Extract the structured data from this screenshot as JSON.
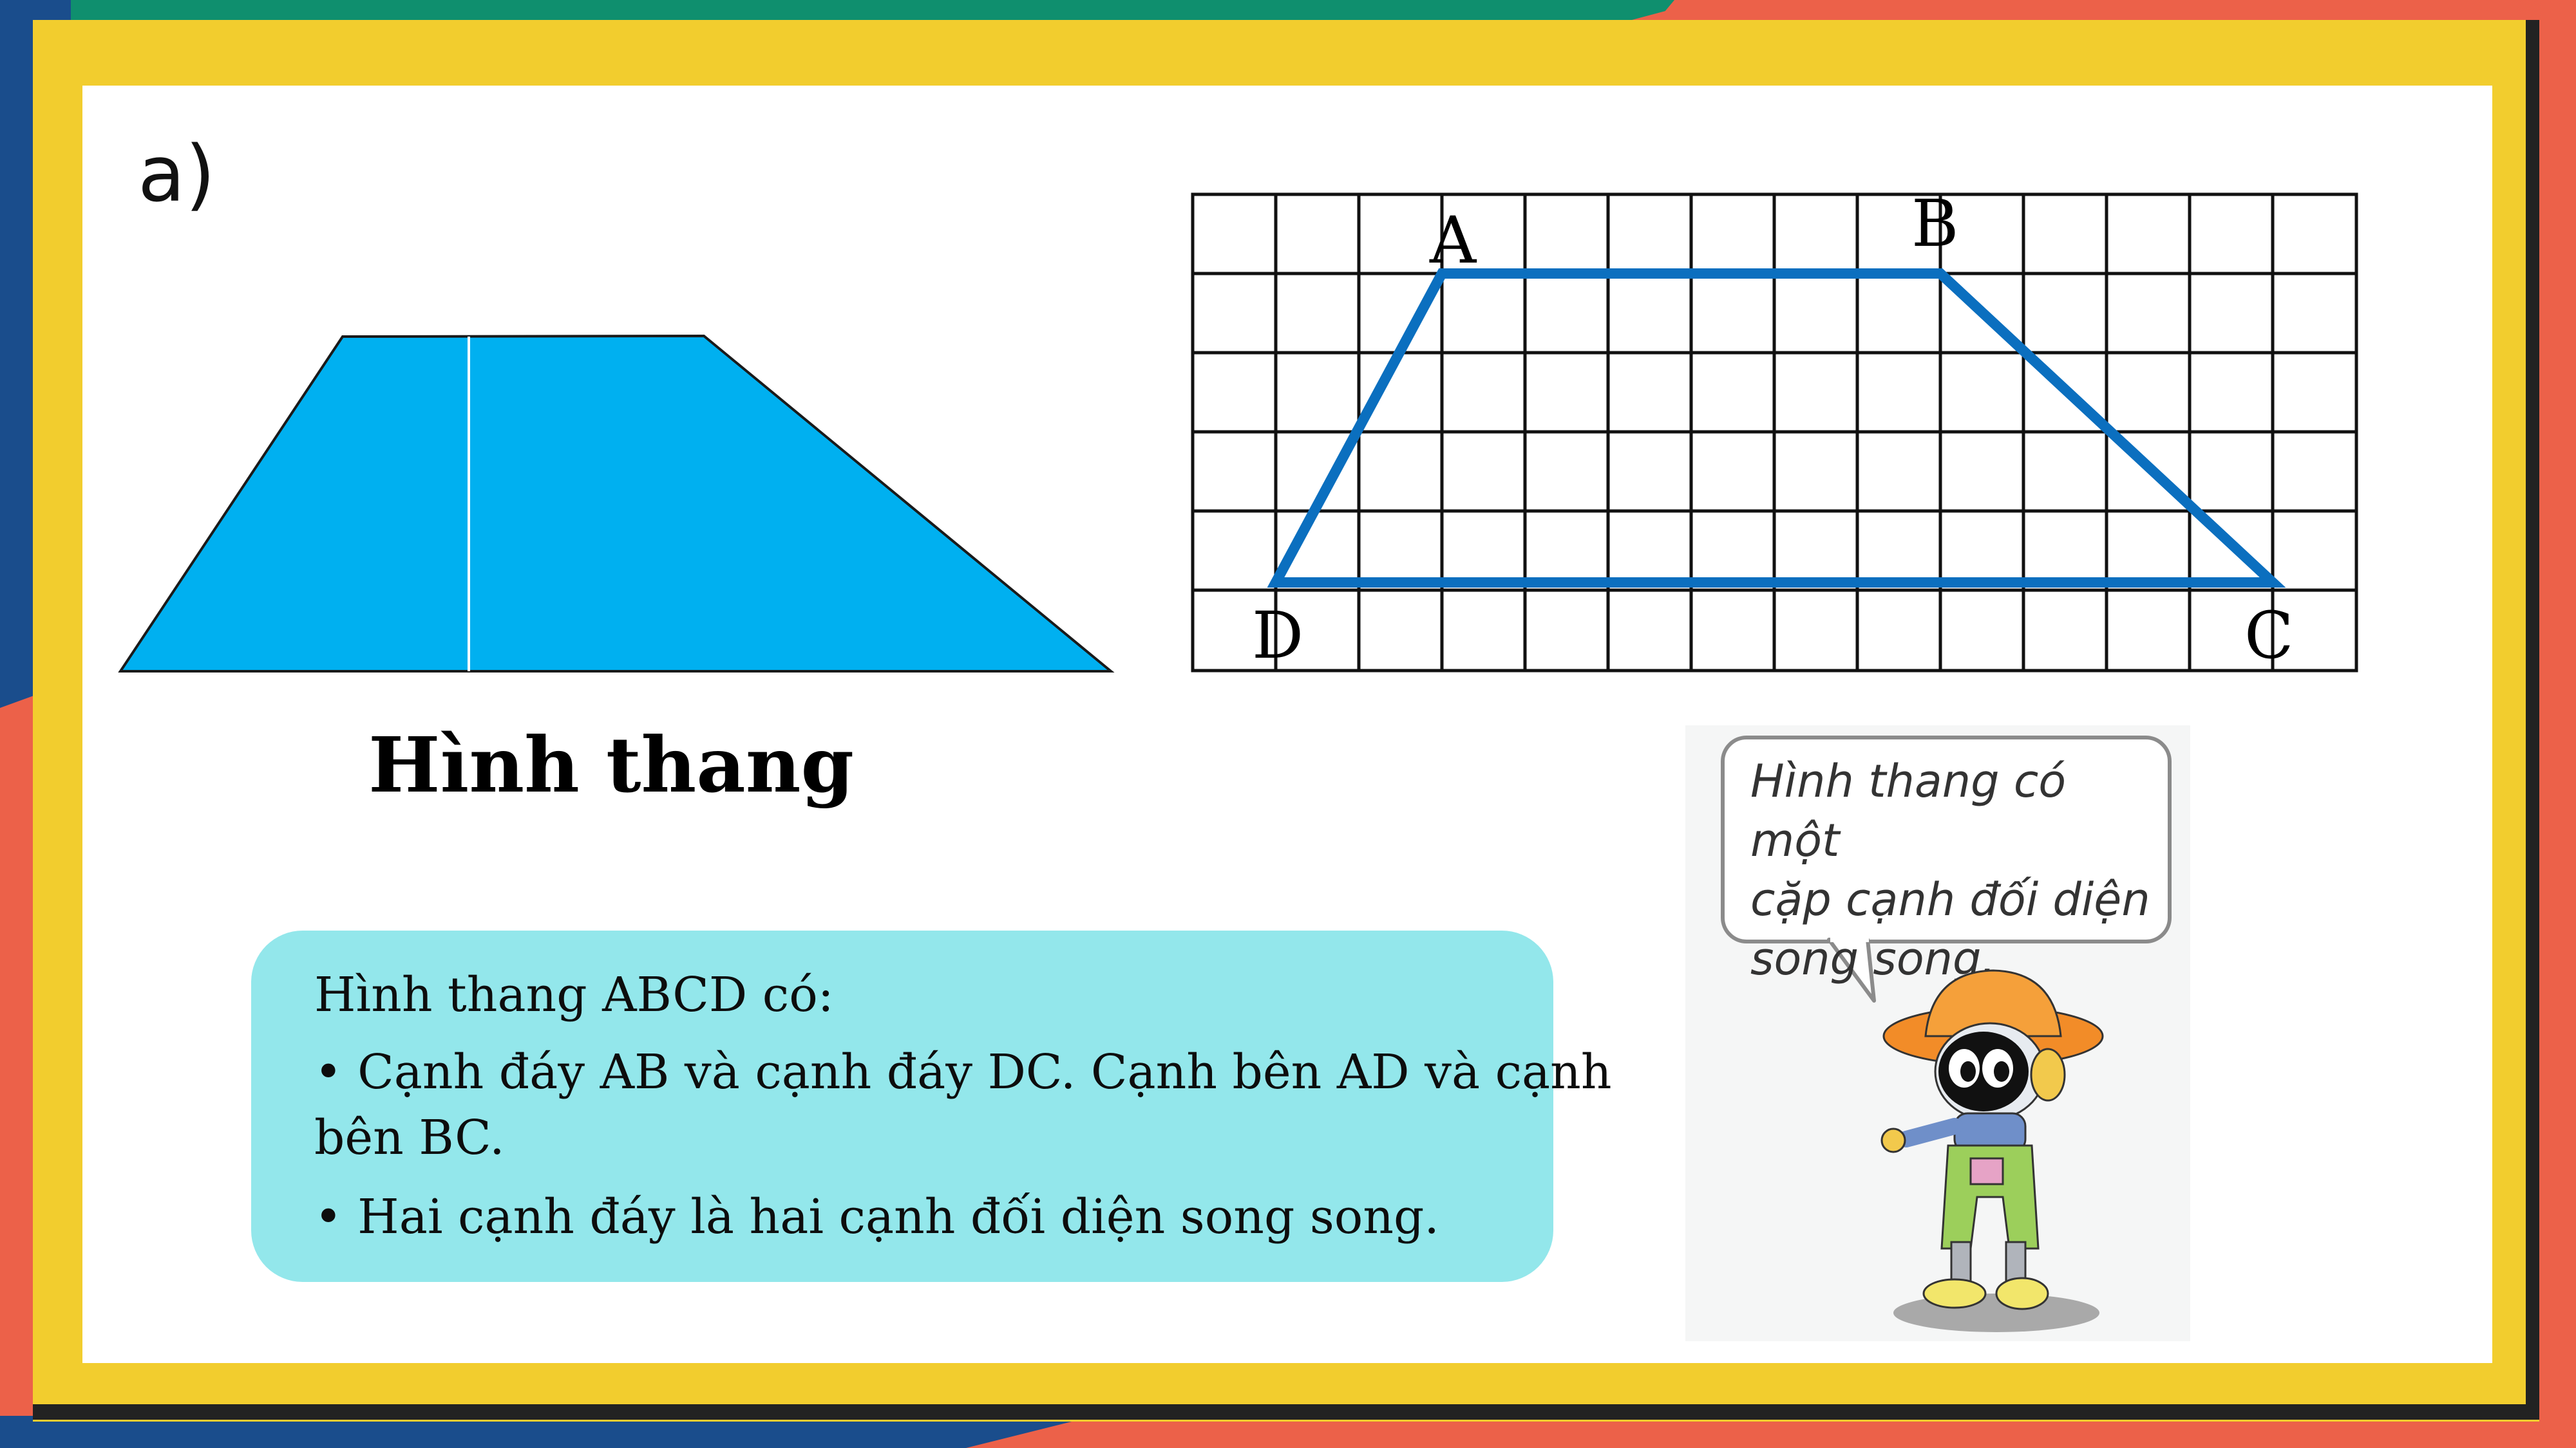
{
  "slide": {
    "part_label": "a)",
    "shape_title": "Hình thang"
  },
  "grid_figure": {
    "vertices": {
      "A": "A",
      "B": "B",
      "C": "C",
      "D": "D"
    }
  },
  "info_box": {
    "heading": "Hình thang ABCD có:",
    "line1": "• Cạnh đáy AB và cạnh đáy DC. Cạnh bên AD và cạnh",
    "line1_cont": "bên BC.",
    "line2": "• Hai cạnh đáy là hai cạnh đối diện song song."
  },
  "speech_bubble": {
    "line1": "Hình thang có một",
    "line2": "cặp cạnh đối diện",
    "line3": "song song."
  },
  "colors": {
    "frame_yellow": "#f2cd2e",
    "trapezoid_fill": "#00b0f0",
    "trapezoid_outline_blue": "#0b6fbf",
    "info_box_bg": "#93e7eb",
    "accent_red": "#ec6149",
    "accent_green": "#0f8f6e",
    "accent_blue": "#1a4d8c"
  }
}
